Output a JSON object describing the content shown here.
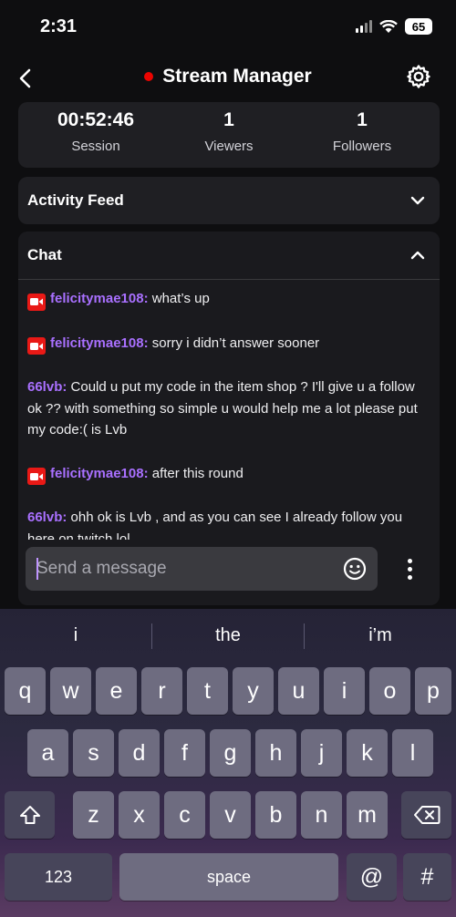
{
  "status_bar": {
    "time": "2:31",
    "battery": "65"
  },
  "nav": {
    "title": "Stream Manager"
  },
  "stats": [
    {
      "value": "00:52:46",
      "label": "Session"
    },
    {
      "value": "1",
      "label": "Viewers"
    },
    {
      "value": "1",
      "label": "Followers"
    }
  ],
  "activity_feed": {
    "title": "Activity Feed"
  },
  "chat": {
    "title": "Chat",
    "messages": [
      {
        "user": "felicitymae108:",
        "text": " what’s up",
        "badge": true
      },
      {
        "user": "felicitymae108:",
        "text": " sorry i didn’t answer sooner",
        "badge": true
      },
      {
        "user": "66lvb:",
        "text": " Could u put my code in the item shop ? I'll give u a follow ok ?? with something so simple u would help me a lot please put my code:( is Lvb",
        "badge": false
      },
      {
        "user": "felicitymae108:",
        "text": " after this round",
        "badge": true
      },
      {
        "user": "66lvb:",
        "text": " ohh ok is Lvb , and as you can see I already follow you here on twitch lol",
        "badge": false
      }
    ],
    "input_placeholder": "Send a message"
  },
  "keyboard": {
    "suggestions": [
      "i",
      "the",
      "i’m"
    ],
    "row1": [
      "q",
      "w",
      "e",
      "r",
      "t",
      "y",
      "u",
      "i",
      "o",
      "p"
    ],
    "row2": [
      "a",
      "s",
      "d",
      "f",
      "g",
      "h",
      "j",
      "k",
      "l"
    ],
    "row3": [
      "z",
      "x",
      "c",
      "v",
      "b",
      "n",
      "m"
    ],
    "numbers_key": "123",
    "space_key": "space",
    "at_key": "@",
    "hash_key": "#"
  },
  "colors": {
    "accent": "#a970ff",
    "live": "#eb0400",
    "badge": "#e91916"
  }
}
